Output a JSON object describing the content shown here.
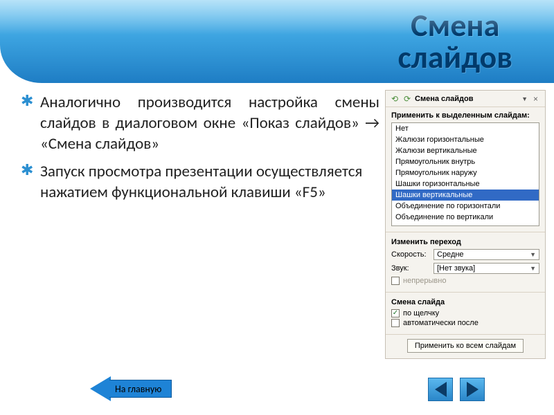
{
  "title_lines": {
    "l1": "Смена",
    "l2": "слайдов"
  },
  "bullets": [
    "Аналогично производится настройка смены слайдов в диалоговом окне «Показ слайдов» → «Смена слайдов»",
    "Запуск просмотра презентации осуществляется нажатием функциональной клавиши «F5»"
  ],
  "home_label": "На главную",
  "panel": {
    "title": "Смена слайдов",
    "close": "×",
    "section_apply": "Применить к выделенным слайдам:",
    "options": [
      "Нет",
      "Жалюзи горизонтальные",
      "Жалюзи вертикальные",
      "Прямоугольник внутрь",
      "Прямоугольник наружу",
      "Шашки горизонтальные",
      "Шашки вертикальные",
      "Объединение по горизонтали",
      "Объединение по вертикали"
    ],
    "selected_index": 6,
    "section_transition": "Изменить переход",
    "speed_label": "Скорость:",
    "speed_value": "Средне",
    "sound_label": "Звук:",
    "sound_value": "[Нет звука]",
    "loop_label": "непрерывно",
    "section_advance": "Смена слайда",
    "on_click": "по щелчку",
    "auto_after": "автоматически после",
    "apply_all": "Применить ко всем слайдам"
  }
}
